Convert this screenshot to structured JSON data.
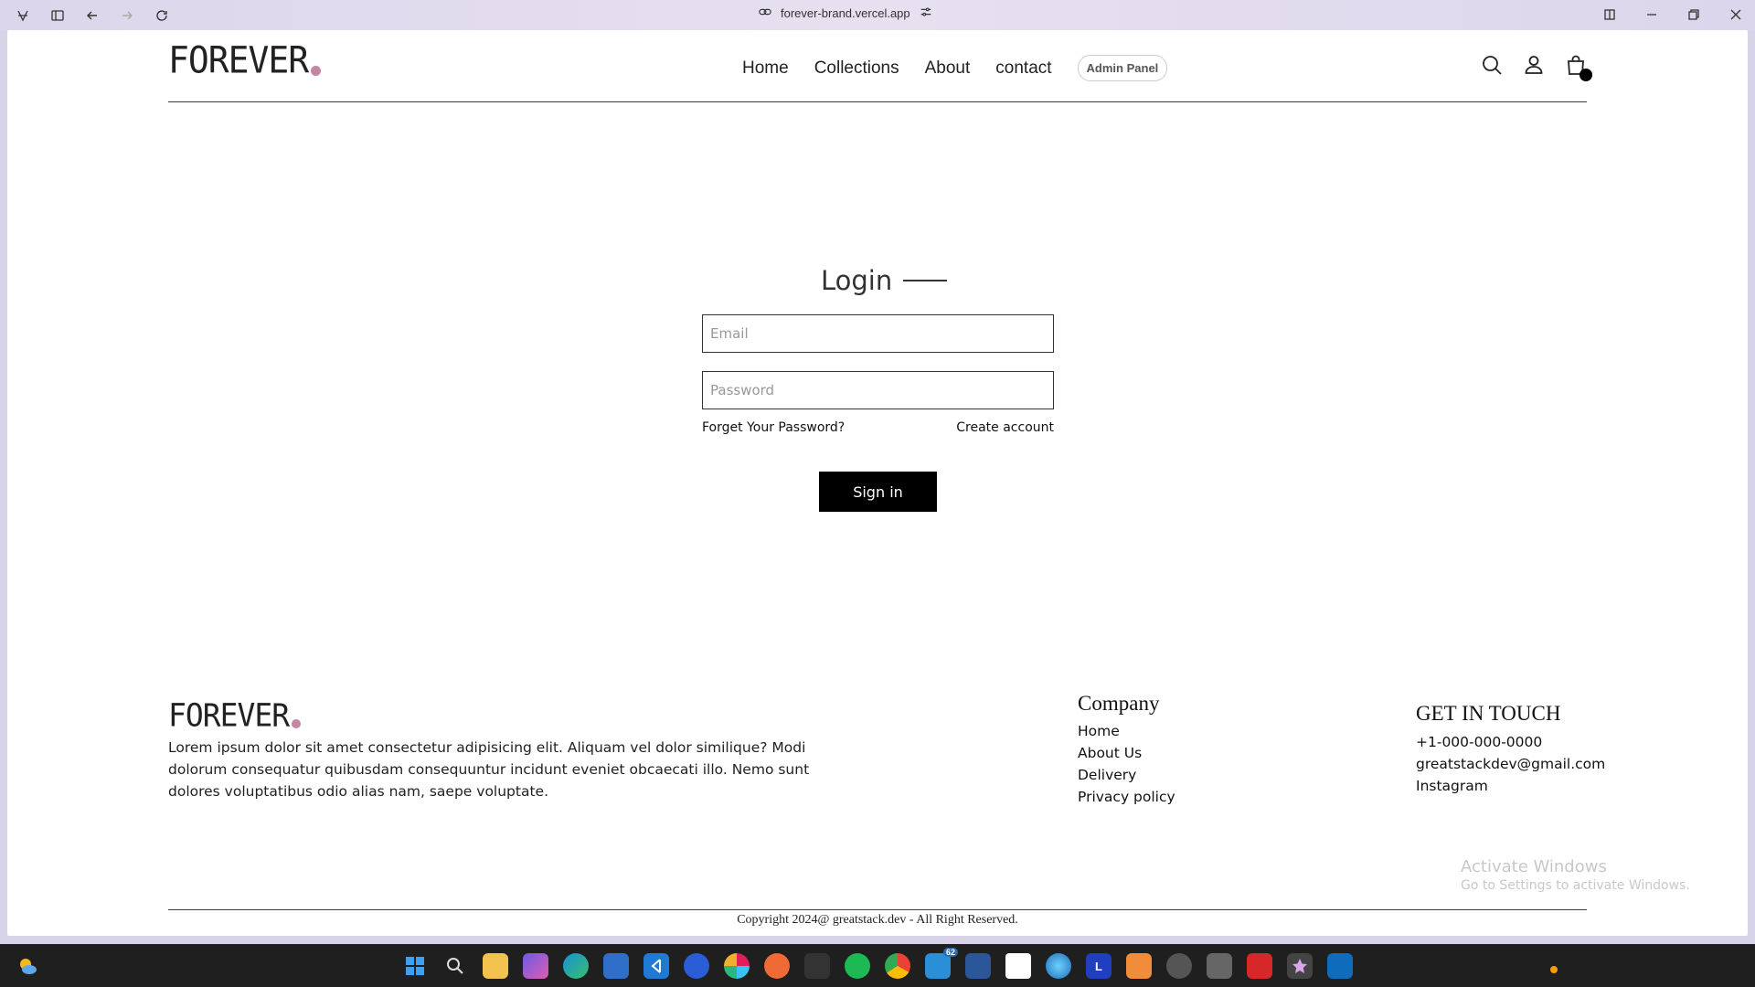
{
  "browser": {
    "url": "forever-brand.vercel.app"
  },
  "nav": {
    "logo": "FOREVER",
    "links": [
      "Home",
      "Collections",
      "About",
      "contact"
    ],
    "admin_label": "Admin Panel",
    "icons": [
      "search-icon",
      "user-icon",
      "bag-icon"
    ]
  },
  "login": {
    "title": "Login",
    "email_placeholder": "Email",
    "password_placeholder": "Password",
    "forgot": "Forget Your Password?",
    "create": "Create account",
    "submit": "Sign in"
  },
  "footer": {
    "logo": "FOREVER",
    "description": "Lorem ipsum dolor sit amet consectetur adipisicing elit. Aliquam vel dolor similique? Modi dolorum consequatur quibusdam consequuntur incidunt eveniet obcaecati illo. Nemo sunt dolores voluptatibus odio alias nam, saepe voluptate.",
    "company_title": "Company",
    "company_links": [
      "Home",
      "About Us",
      "Delivery",
      "Privacy policy"
    ],
    "contact_title": "GET IN TOUCH",
    "contact_items": [
      "+1-000-000-0000",
      "greatstackdev@gmail.com",
      "Instagram"
    ],
    "copyright": "Copyright 2024@ greatstack.dev - All Right Reserved."
  },
  "watermark": {
    "line1": "Activate Windows",
    "line2": "Go to Settings to activate Windows."
  },
  "taskbar": {
    "badge_count": "62",
    "l_app": "L"
  },
  "colors": {
    "logo_dot": "#c586a5",
    "button_bg": "#000000"
  }
}
